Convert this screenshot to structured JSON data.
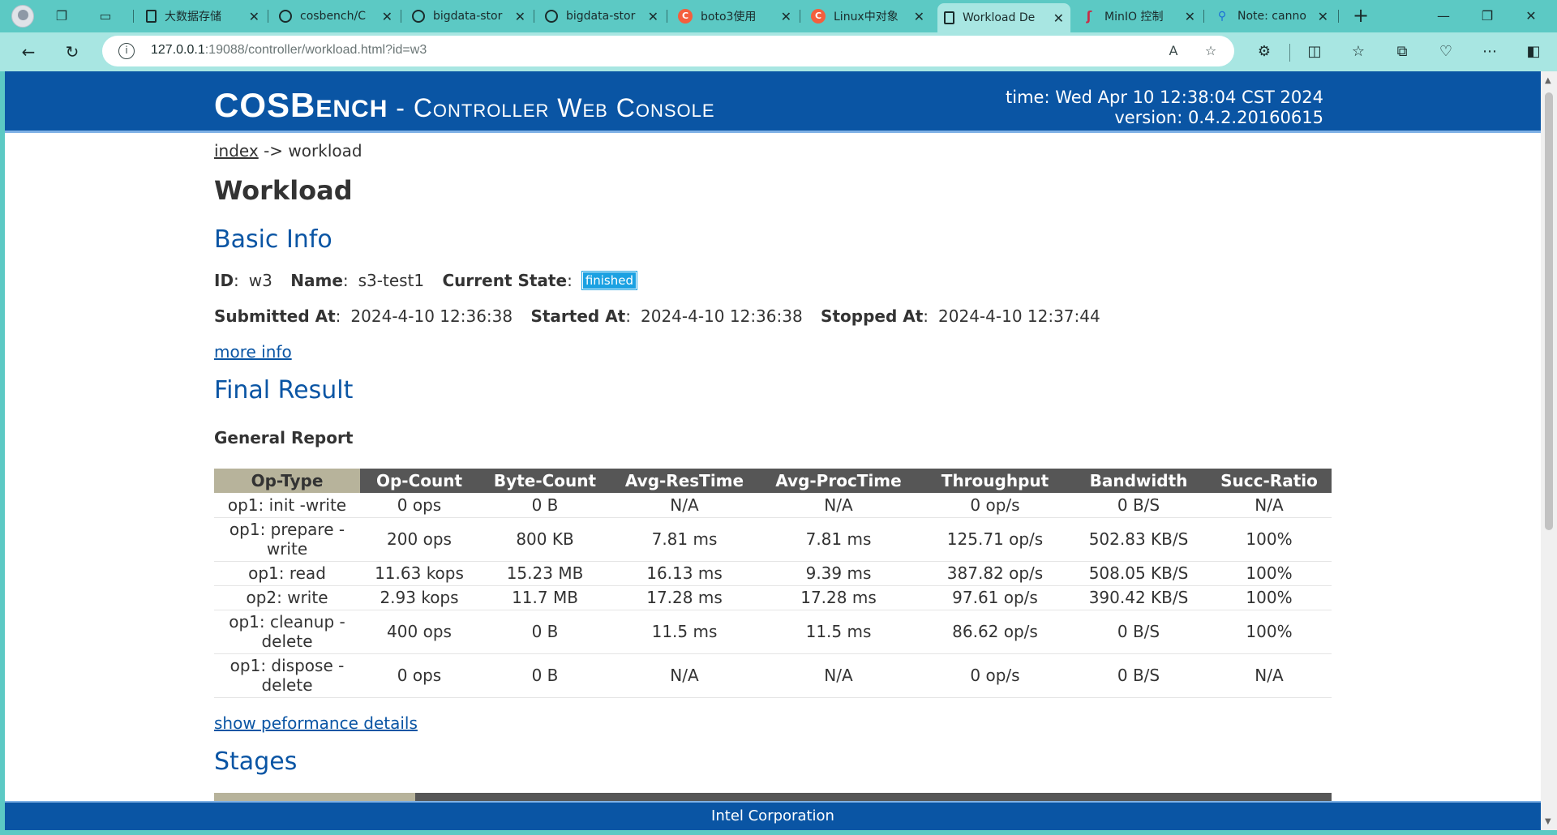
{
  "tabs": [
    {
      "label": "大数据存储",
      "favicon": "doc-icon"
    },
    {
      "label": "cosbench/C",
      "favicon": "github-icon"
    },
    {
      "label": "bigdata-stor",
      "favicon": "github-icon"
    },
    {
      "label": "bigdata-stor",
      "favicon": "github-icon"
    },
    {
      "label": "boto3使用",
      "favicon": "csdn-icon"
    },
    {
      "label": "Linux中对象",
      "favicon": "csdn-icon"
    },
    {
      "label": "Workload De",
      "favicon": "doc-icon"
    },
    {
      "label": "MinIO 控制",
      "favicon": "minio-icon"
    },
    {
      "label": "Note: canno",
      "favicon": "search-icon"
    }
  ],
  "active_tab_index": 6,
  "address_bar": {
    "host": "127.0.0.1",
    "rest": ":19088/controller/workload.html?id=w3"
  },
  "header": {
    "title_big1": "COSB",
    "title_small1": "ench",
    "title_sep": " - ",
    "title_rest": "Controller Web Console",
    "time": "time: Wed Apr 10 12:38:04 CST 2024",
    "version": "version: 0.4.2.20160615"
  },
  "breadcrumb": {
    "index": "index",
    "arrow": " -> ",
    "current": "workload"
  },
  "page_title": "Workload",
  "basic_info": {
    "heading": "Basic Info",
    "id_label": "ID",
    "id_value": "w3",
    "name_label": "Name",
    "name_value": "s3-test1",
    "state_label": "Current State",
    "state_value": "finished",
    "submitted_label": "Submitted At",
    "submitted_value": "2024-4-10 12:36:38",
    "started_label": "Started At",
    "started_value": "2024-4-10 12:36:38",
    "stopped_label": "Stopped At",
    "stopped_value": "2024-4-10 12:37:44",
    "more_info": "more info"
  },
  "final_result": {
    "heading": "Final Result",
    "general_report": "General Report",
    "columns": [
      "Op-Type",
      "Op-Count",
      "Byte-Count",
      "Avg-ResTime",
      "Avg-ProcTime",
      "Throughput",
      "Bandwidth",
      "Succ-Ratio"
    ],
    "rows": [
      [
        "op1: init -write",
        "0 ops",
        "0 B",
        "N/A",
        "N/A",
        "0 op/s",
        "0 B/S",
        "N/A"
      ],
      [
        "op1: prepare -write",
        "200 ops",
        "800 KB",
        "7.81 ms",
        "7.81 ms",
        "125.71 op/s",
        "502.83 KB/S",
        "100%"
      ],
      [
        "op1: read",
        "11.63 kops",
        "15.23 MB",
        "16.13 ms",
        "9.39 ms",
        "387.82 op/s",
        "508.05 KB/S",
        "100%"
      ],
      [
        "op2: write",
        "2.93 kops",
        "11.7 MB",
        "17.28 ms",
        "17.28 ms",
        "97.61 op/s",
        "390.42 KB/S",
        "100%"
      ],
      [
        "op1: cleanup -delete",
        "400 ops",
        "0 B",
        "11.5 ms",
        "11.5 ms",
        "86.62 op/s",
        "0 B/S",
        "100%"
      ],
      [
        "op1: dispose -delete",
        "0 ops",
        "0 B",
        "N/A",
        "N/A",
        "0 op/s",
        "0 B/S",
        "N/A"
      ]
    ],
    "show_details": "show peformance details"
  },
  "stages": {
    "heading": "Stages"
  },
  "footer": "Intel Corporation"
}
